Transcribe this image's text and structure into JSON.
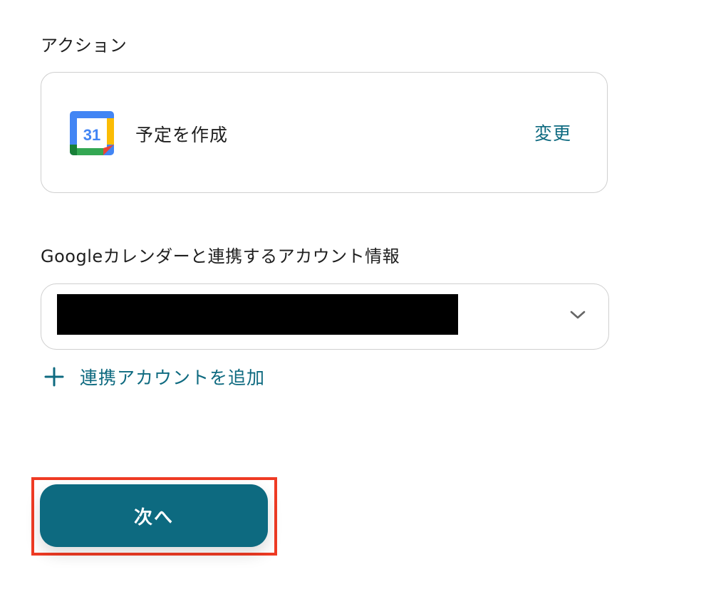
{
  "action": {
    "section_label": "アクション",
    "app_icon": "google-calendar-icon",
    "app_icon_text": "31",
    "name": "予定を作成",
    "change_label": "変更"
  },
  "account": {
    "section_label": "Googleカレンダーと連携するアカウント情報",
    "selected_value": "",
    "chevron_icon": "chevron-down-icon",
    "add_label": "連携アカウントを追加",
    "add_icon": "plus-icon"
  },
  "footer": {
    "next_label": "次へ"
  },
  "colors": {
    "accent": "#0d6a80",
    "highlight": "#ef3b24",
    "border": "#cfcfcf"
  }
}
